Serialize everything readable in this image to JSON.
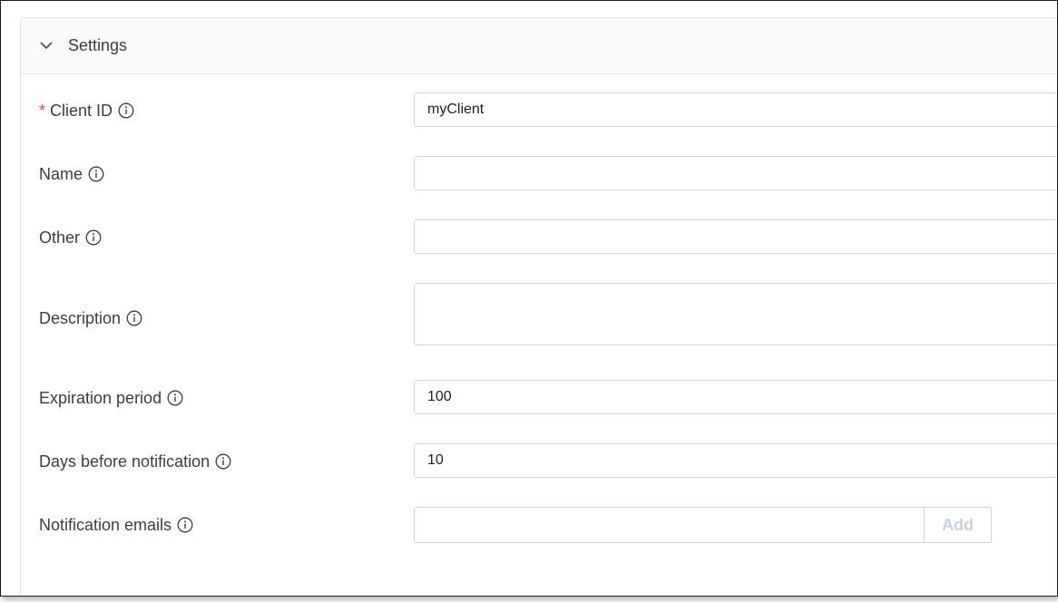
{
  "panel": {
    "title": "Settings",
    "toggle_icon": "chevron-down-icon"
  },
  "fields": {
    "client_id": {
      "label": "Client ID",
      "required_marker": "*",
      "value": "myClient",
      "info_icon": "info-icon"
    },
    "name": {
      "label": "Name",
      "value": "",
      "info_icon": "info-icon"
    },
    "other": {
      "label": "Other",
      "value": "",
      "info_icon": "info-icon"
    },
    "description": {
      "label": "Description",
      "value": "",
      "info_icon": "info-icon"
    },
    "expiration_period": {
      "label": "Expiration period",
      "value": "100",
      "info_icon": "info-icon"
    },
    "days_before_notification": {
      "label": "Days before notification",
      "value": "10",
      "info_icon": "info-icon"
    },
    "notification_emails": {
      "label": "Notification emails",
      "value": "",
      "add_label": "Add",
      "info_icon": "info-icon"
    }
  },
  "colors": {
    "required": "#e0434b",
    "label": "#3d3d3d",
    "border": "#d4d4d4",
    "add_disabled": "#c7d2e8"
  }
}
